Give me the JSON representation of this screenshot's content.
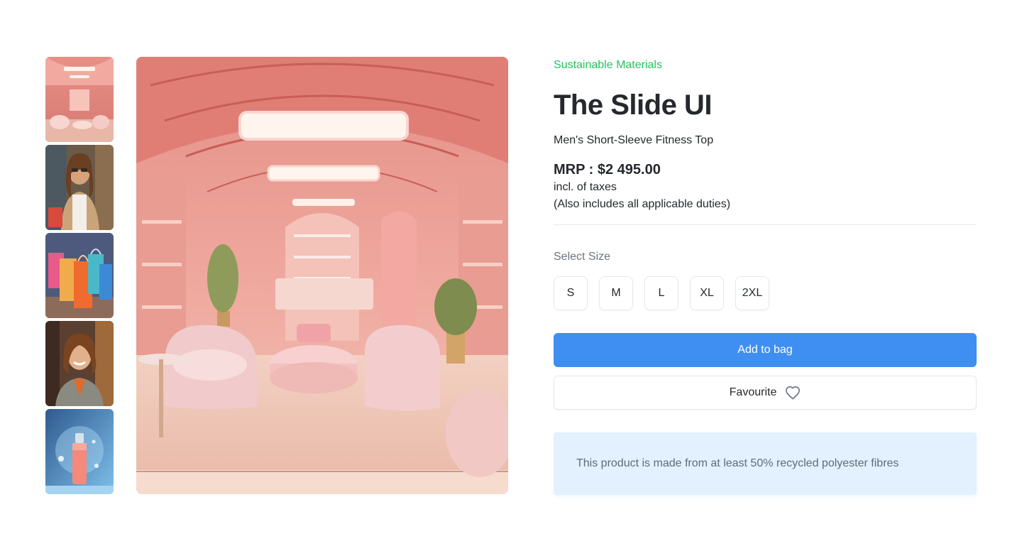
{
  "product": {
    "eyebrow": "Sustainable Materials",
    "title": "The Slide UI",
    "subtitle": "Men's Short-Sleeve Fitness Top",
    "price": "MRP : $2 495.00",
    "tax_note": "incl. of taxes",
    "duties_note": "(Also includes all applicable duties)"
  },
  "size_selector": {
    "label": "Select Size",
    "options": [
      "S",
      "M",
      "L",
      "XL",
      "2XL"
    ]
  },
  "actions": {
    "add_to_bag": "Add to bag",
    "favourite": "Favourite"
  },
  "info": {
    "text": "This product is made from at least 50% recycled polyester fibres"
  },
  "gallery": {
    "thumbnails": [
      "pink-store-interior",
      "woman-with-shopping-bag",
      "colorful-shopping-bags",
      "smiling-woman-in-store",
      "pink-cosmetic-bottle"
    ],
    "main": "pink-store-interior"
  },
  "colors": {
    "accent": "#3f8ff2",
    "eyebrow": "#22c55e",
    "info_bg": "#e3f0fd"
  },
  "icons": {
    "favourite": "heart-icon"
  }
}
